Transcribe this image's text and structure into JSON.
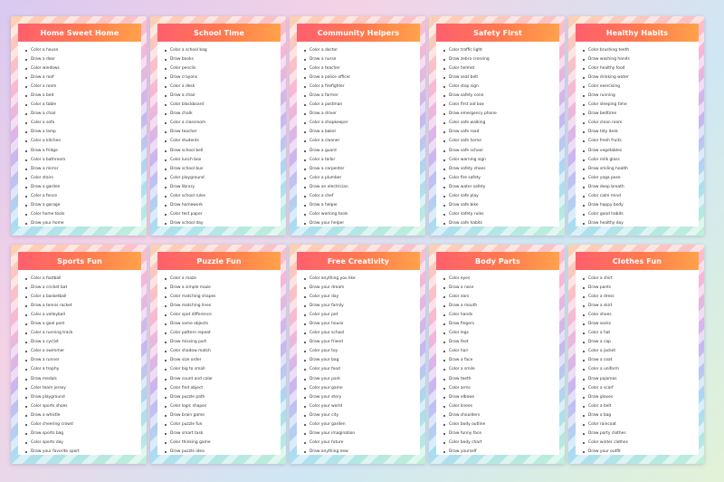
{
  "cards": [
    {
      "title": "Home Sweet Home",
      "items": [
        "Color a house",
        "Draw a door",
        "Color windows",
        "Draw a roof",
        "Color a room",
        "Draw a bed",
        "Color a table",
        "Draw a chair",
        "Color a sofa",
        "Draw a lamp",
        "Color a kitchen",
        "Draw a fridge",
        "Color a bathroom",
        "Draw a mirror",
        "Color stairs",
        "Draw a garden",
        "Color a fence",
        "Draw a garage",
        "Color home tools",
        "Draw your home"
      ]
    },
    {
      "title": "School Time",
      "items": [
        "Color a school bag",
        "Draw books",
        "Color pencils",
        "Draw crayons",
        "Color a desk",
        "Draw a chair",
        "Color blackboard",
        "Draw chalk",
        "Color a classroom",
        "Draw teacher",
        "Color students",
        "Draw school bell",
        "Color lunch box",
        "Draw school bus",
        "Color playground",
        "Draw library",
        "Color school rules",
        "Draw homework",
        "Color test paper",
        "Draw school day"
      ]
    },
    {
      "title": "Community Helpers",
      "items": [
        "Color a doctor",
        "Draw a nurse",
        "Color a teacher",
        "Draw a police officer",
        "Color a firefighter",
        "Draw a farmer",
        "Color a postman",
        "Draw a driver",
        "Color a shopkeeper",
        "Draw a baker",
        "Color a cleaner",
        "Draw a guard",
        "Color a tailor",
        "Draw a carpenter",
        "Color a plumber",
        "Draw an electrician",
        "Color a chef",
        "Draw a helper",
        "Color working tools",
        "Draw your helper"
      ]
    },
    {
      "title": "Safety First",
      "items": [
        "Color traffic light",
        "Draw zebra crossing",
        "Color helmet",
        "Draw seat belt",
        "Color stop sign",
        "Draw safety cone",
        "Color first aid box",
        "Draw emergency phone",
        "Color safe walking",
        "Draw safe road",
        "Color safe home",
        "Draw safe school",
        "Color warning sign",
        "Draw safety shoes",
        "Color fire safety",
        "Draw water safety",
        "Color safe play",
        "Draw safe bike",
        "Color safety rules",
        "Draw safe habits"
      ]
    },
    {
      "title": "Healthy Habits",
      "items": [
        "Color brushing teeth",
        "Draw washing hands",
        "Color healthy food",
        "Draw drinking water",
        "Color exercising",
        "Draw running",
        "Color sleeping time",
        "Draw bedtime",
        "Color clean room",
        "Draw tidy desk",
        "Color fresh fruits",
        "Draw vegetables",
        "Color milk glass",
        "Draw smiling health",
        "Color yoga pose",
        "Draw deep breath",
        "Color calm mind",
        "Draw happy body",
        "Color good habits",
        "Draw healthy day"
      ]
    },
    {
      "title": "Sports Fun",
      "items": [
        "Color a football",
        "Draw a cricket bat",
        "Color a basketball",
        "Draw a tennis racket",
        "Color a volleyball",
        "Draw a goal post",
        "Color a running track",
        "Draw a cyclist",
        "Color a swimmer",
        "Draw a runner",
        "Color a trophy",
        "Draw medals",
        "Color team jersey",
        "Draw playground",
        "Color sports shoes",
        "Draw a whistle",
        "Color cheering crowd",
        "Draw sports bag",
        "Color sports day",
        "Draw your favorite sport"
      ]
    },
    {
      "title": "Puzzle Fun",
      "items": [
        "Color a maze",
        "Draw a simple maze",
        "Color matching shapes",
        "Draw matching lines",
        "Color spot difference",
        "Draw same objects",
        "Color pattern repeat",
        "Draw missing part",
        "Color shadow match",
        "Draw size order",
        "Color big to small",
        "Draw count and color",
        "Color find object",
        "Draw puzzle path",
        "Color logic shapes",
        "Draw brain game",
        "Color puzzle fun",
        "Draw smart task",
        "Color thinking game",
        "Draw puzzle idea"
      ]
    },
    {
      "title": "Free Creativity",
      "items": [
        "Color anything you like",
        "Draw your dream",
        "Color your day",
        "Draw your family",
        "Color your pet",
        "Draw your house",
        "Color your school",
        "Draw your friend",
        "Color your toy",
        "Draw your bag",
        "Color your food",
        "Draw your park",
        "Color your game",
        "Draw your story",
        "Color your world",
        "Draw your city",
        "Color your garden",
        "Draw your imagination",
        "Color your future",
        "Draw anything new"
      ]
    },
    {
      "title": "Body Parts",
      "items": [
        "Color eyes",
        "Draw a nose",
        "Color ears",
        "Draw a mouth",
        "Color hands",
        "Draw fingers",
        "Color legs",
        "Draw feet",
        "Color hair",
        "Draw a face",
        "Color a smile",
        "Draw teeth",
        "Color arms",
        "Draw elbows",
        "Color knees",
        "Draw shoulders",
        "Color body outline",
        "Draw funny face",
        "Color body chart",
        "Draw yourself"
      ]
    },
    {
      "title": "Clothes Fun",
      "items": [
        "Color a shirt",
        "Draw pants",
        "Color a dress",
        "Draw a skirt",
        "Color shoes",
        "Draw socks",
        "Color a hat",
        "Draw a cap",
        "Color a jacket",
        "Draw a coat",
        "Color a uniform",
        "Draw pajamas",
        "Color a scarf",
        "Draw gloves",
        "Color a belt",
        "Draw a bag",
        "Color raincoat",
        "Draw party clothes",
        "Color winter clothes",
        "Draw your outfit"
      ]
    }
  ]
}
